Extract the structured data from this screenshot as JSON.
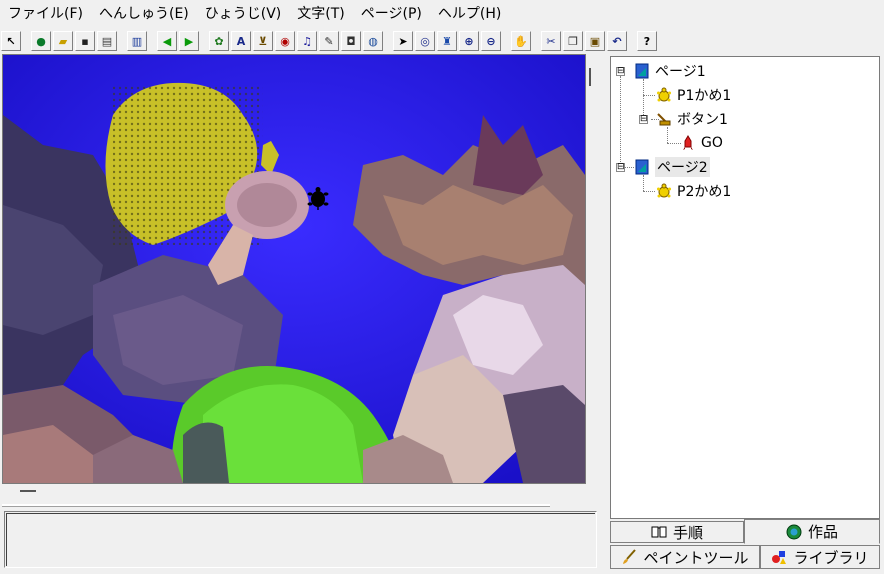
{
  "menu": [
    "ファイル(F)",
    "へんしゅう(E)",
    "ひょうじ(V)",
    "文字(T)",
    "ページ(P)",
    "ヘルプ(H)"
  ],
  "toolbar": {
    "buttons": [
      {
        "name": "pointer-tool-icon",
        "glyph": "↖",
        "color": "#000000"
      },
      {
        "name": "globe-icon",
        "glyph": "●",
        "color": "#0a7a2a"
      },
      {
        "name": "open-folder-icon",
        "glyph": "▰",
        "color": "#c8a000"
      },
      {
        "name": "save-disk-icon",
        "glyph": "▪",
        "color": "#202020"
      },
      {
        "name": "print-icon",
        "glyph": "▤",
        "color": "#404040"
      },
      {
        "name": "page-view-icon",
        "glyph": "▥",
        "color": "#1a3a9a"
      },
      {
        "name": "arrow-left-icon",
        "glyph": "◀",
        "color": "#0a9a0a"
      },
      {
        "name": "arrow-right-icon",
        "glyph": "▶",
        "color": "#0a9a0a"
      },
      {
        "name": "turtle-tool-icon",
        "glyph": "✿",
        "color": "#207a20"
      },
      {
        "name": "text-box-icon",
        "glyph": "A",
        "color": "#1a2a8a"
      },
      {
        "name": "button-tool-icon",
        "glyph": "⊻",
        "color": "#6a4a00"
      },
      {
        "name": "eye-view-icon",
        "glyph": "◉",
        "color": "#b00000"
      },
      {
        "name": "music-note-icon",
        "glyph": "♫",
        "color": "#1a1a9a"
      },
      {
        "name": "pen-tool-icon",
        "glyph": "✎",
        "color": "#303030"
      },
      {
        "name": "movie-camera-icon",
        "glyph": "◘",
        "color": "#303030"
      },
      {
        "name": "globe-world-icon",
        "glyph": "◍",
        "color": "#1a4a9a"
      },
      {
        "name": "select-arrow-icon",
        "glyph": "➤",
        "color": "#000000"
      },
      {
        "name": "eye-icon",
        "glyph": "◎",
        "color": "#1a2a8a"
      },
      {
        "name": "stamp-icon",
        "glyph": "♜",
        "color": "#1a4aaa"
      },
      {
        "name": "zoom-in-icon",
        "glyph": "⊕",
        "color": "#1a2a8a"
      },
      {
        "name": "zoom-out-icon",
        "glyph": "⊖",
        "color": "#1a2a8a"
      },
      {
        "name": "stop-hand-icon",
        "glyph": "✋",
        "color": "#c00000"
      },
      {
        "name": "cut-icon",
        "glyph": "✂",
        "color": "#1a2a8a"
      },
      {
        "name": "copy-icon",
        "glyph": "❐",
        "color": "#303030"
      },
      {
        "name": "paste-icon",
        "glyph": "▣",
        "color": "#6a4a00"
      },
      {
        "name": "undo-icon",
        "glyph": "↶",
        "color": "#1a2a8a"
      },
      {
        "name": "help-icon",
        "glyph": "?",
        "color": "#000000"
      }
    ]
  },
  "tree": {
    "nodes": [
      {
        "label": "ページ1",
        "icon": "page-icon",
        "expander": "⊟"
      },
      {
        "label": "P1かめ1",
        "icon": "turtle-icon"
      },
      {
        "label": "ボタン1",
        "icon": "button-icon",
        "expander": "⊟"
      },
      {
        "label": "GO",
        "icon": "rocket-icon"
      },
      {
        "label": "ページ2",
        "icon": "page-icon",
        "expander": "⊟"
      },
      {
        "label": "P2かめ1",
        "icon": "turtle-icon"
      }
    ]
  },
  "tabs": {
    "procedure": "手順",
    "work": "作品",
    "paint_tool": "ペイントツール",
    "library": "ライブラリ"
  },
  "colors": {
    "water": "#2a1ef0",
    "sponge": "#c8c028",
    "coral_pink": "#b89aa8",
    "algae": "#5aca2a"
  }
}
